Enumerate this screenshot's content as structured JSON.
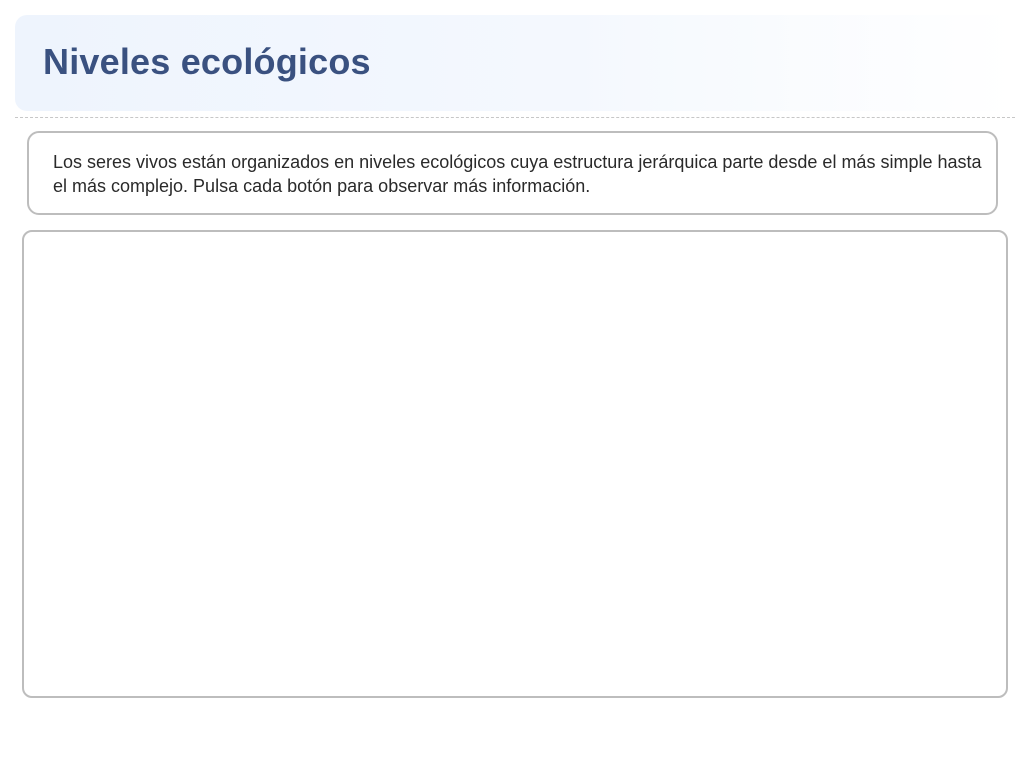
{
  "header": {
    "title": "Niveles ecológicos"
  },
  "intro": {
    "text": "Los seres vivos están organizados en niveles ecológicos cuya estructura jerárquica parte desde el más simple hasta el más complejo. Pulsa cada botón para observar más información."
  },
  "colors": {
    "title": "#3a5180",
    "header_bg": "#eef4fd",
    "border": "#bdbdbd",
    "text": "#2a2a2a"
  }
}
